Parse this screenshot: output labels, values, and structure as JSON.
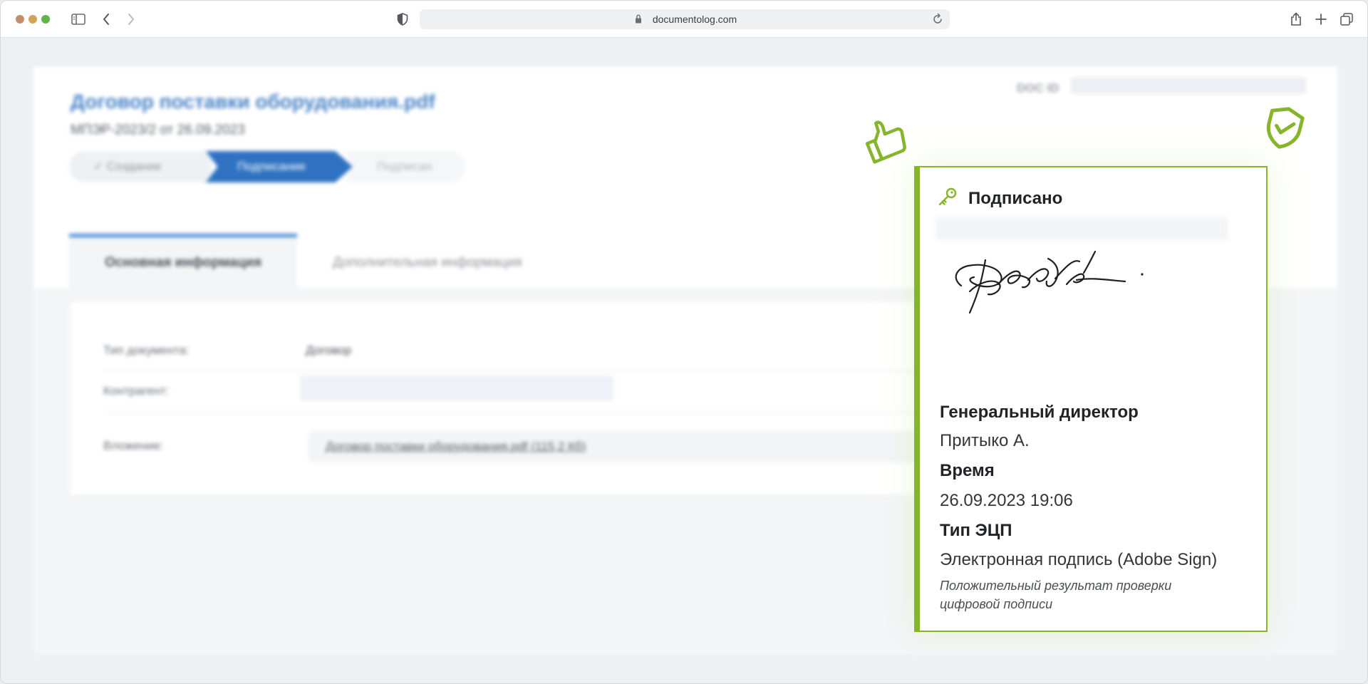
{
  "browser": {
    "url": "documentolog.com"
  },
  "document": {
    "title": "Договор поставки оборудования.pdf",
    "subtitle": "МПЭР-2023/2 от 26.09.2023",
    "doc_id_label": "DOC ID"
  },
  "steps": [
    {
      "label": "✓ Создание"
    },
    {
      "label": "Подписание"
    },
    {
      "label": "Подписан"
    }
  ],
  "tabs": [
    {
      "label": "Основная информация"
    },
    {
      "label": "Дополнительная информация"
    }
  ],
  "info": {
    "doc_type_label": "Тип документа:",
    "doc_type_value": "Договор",
    "counterparty_label": "Контрагент:",
    "attachment_label": "Вложение:",
    "attachment_value": "Договор поставки оборудования.pdf (115,2 Кб)"
  },
  "signature": {
    "status": "Подписано",
    "position": "Генеральный директор",
    "name": "Притыко А.",
    "time_label": "Время",
    "time_value": "26.09.2023 19:06",
    "type_label": "Тип ЭЦП",
    "type_value": "Электронная подпись (Adobe Sign)",
    "verification_note": "Положительный результат проверки цифровой подписи"
  },
  "colors": {
    "accent_green": "#86b52c",
    "brand_blue": "#2f72c2",
    "link_blue": "#4a83c7"
  },
  "icons": {
    "status_icon": "key-icon",
    "decor_left": "thumbs-up-icon",
    "decor_right": "shield-check-icon"
  }
}
